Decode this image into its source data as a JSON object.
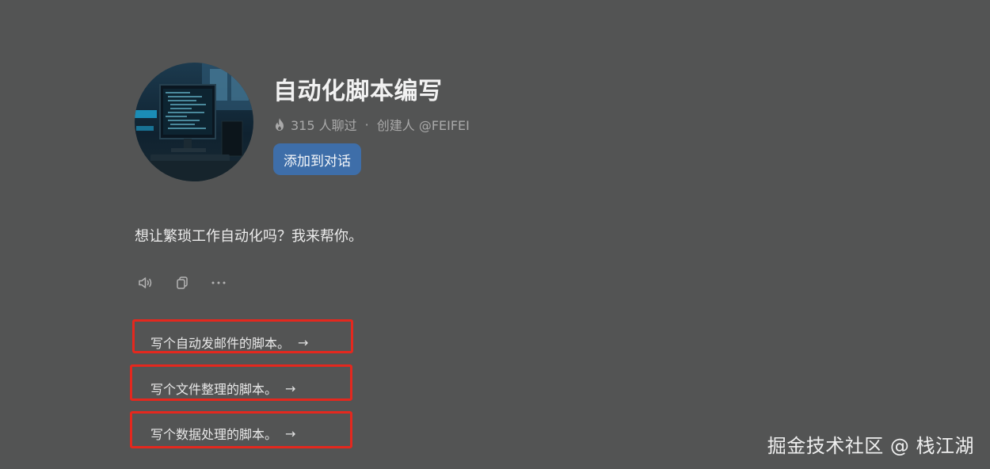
{
  "assistant": {
    "name": "自动化脚本编写",
    "chat_count": "315 人聊过",
    "separator": "·",
    "creator": "创建人 @FEIFEI",
    "add_button": "添加到对话"
  },
  "message": "想让繁琐工作自动化吗？我来帮你。",
  "actions": [
    {
      "icon": "speaker-icon"
    },
    {
      "icon": "copy-icon"
    },
    {
      "icon": "more-icon"
    }
  ],
  "suggestions": [
    {
      "text": "写个自动发邮件的脚本。",
      "arrow": "→"
    },
    {
      "text": "写个文件整理的脚本。",
      "arrow": "→"
    },
    {
      "text": "写个数据处理的脚本。",
      "arrow": "→"
    }
  ],
  "colors": {
    "background": "#535454",
    "button": "#3e6ea9",
    "highlight": "#e4281e"
  },
  "watermark": "掘金技术社区 @ 栈江湖"
}
